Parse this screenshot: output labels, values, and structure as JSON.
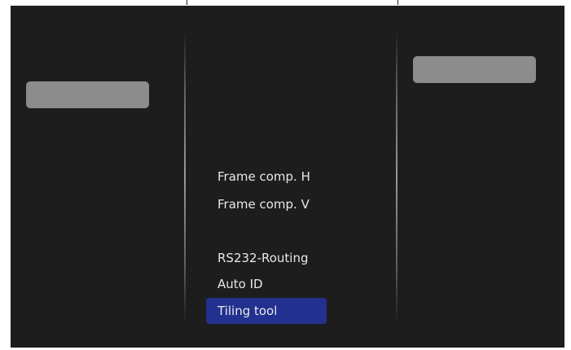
{
  "menu": {
    "items": [
      {
        "label": "Frame comp. H"
      },
      {
        "label": "Frame comp. V"
      },
      {
        "label": "RS232-Routing"
      },
      {
        "label": "Auto ID"
      },
      {
        "label": "Tiling tool",
        "selected": true
      }
    ]
  },
  "colors": {
    "screen_background": "#1d1d1d",
    "placeholder_box": "#8c8c8c",
    "selection": "#22308f",
    "text": "#e8e8e8"
  }
}
